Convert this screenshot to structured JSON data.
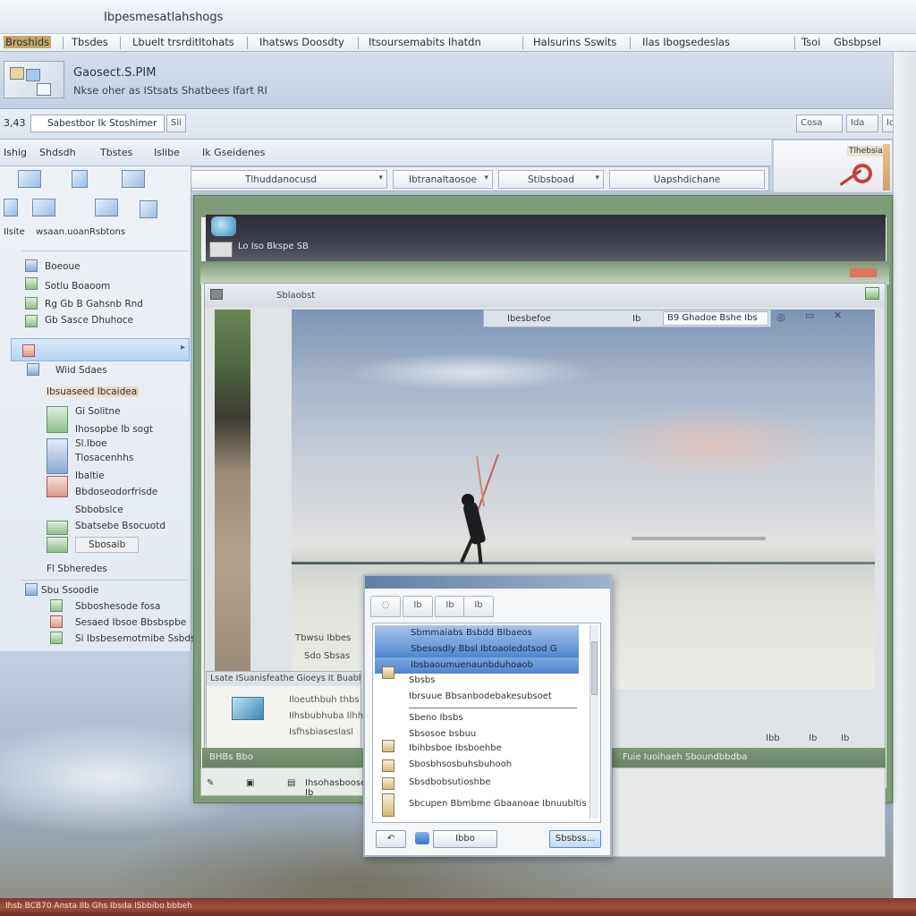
{
  "window": {
    "title": "Ibpesmesatlahshogs"
  },
  "menubar": {
    "items": [
      "Broshids",
      "Tbsdes",
      "Lbuelt trsrdit",
      "Itohats",
      "Ihatsws Doosdty",
      "Itsoursemabits Ihatdn",
      "Halsurins  Sswits",
      "Ilas Ibogsedeslas",
      "Tsoi",
      "Gbsbpsel"
    ]
  },
  "ribbon": {
    "title": "Gaosect.S.PIM",
    "subtitle": "Nkse oher as IStsats Shatbees Ifart RI"
  },
  "addressbar": {
    "num": "3,43",
    "path": "Sabestbor Ik Stoshimer",
    "path_btn": "Sli",
    "right_buttons": [
      "Cosa",
      "Ida",
      "Io"
    ]
  },
  "cmdrow": {
    "items": [
      "Ishig",
      "Shdsdh",
      "Tbstes",
      "Islibe",
      "Ik  Gseidenes"
    ]
  },
  "filters": {
    "dropdowns": [
      "Tlhuddanocusd",
      "Ibtranaltaosoe",
      "Stibsboad",
      "Uapshdichane"
    ]
  },
  "tool_badge": {
    "label": "Tlhebsiar"
  },
  "leftpanel": {
    "icons": [
      {
        "label": ""
      },
      {
        "label": ""
      },
      {
        "label": ""
      },
      {
        "label": "Ilsite"
      },
      {
        "label": "wsaan.uoan"
      },
      {
        "label": "Rsbtons"
      }
    ],
    "tree": [
      "Boeoue",
      "Sotlu Boaoom",
      "Rg Gb B Gahsnb Rnd",
      "Gb Sasce Dhuhoce",
      "Wiid Sdaes",
      "Ibsuaseed Ibcaidea",
      "Gi Solitne",
      "Ihosopbe Ib sogt",
      "Sl.Iboe",
      "Tlosacenhhs",
      "Ibaltie",
      "Bbdoseodorfrisde",
      "Sbbobslce",
      "Sbatsebe  Bsocuotd",
      "Sbosaib",
      "Fl Sbheredes",
      "Sbu Ssoodie",
      "Sbboshesode fosa",
      "Sesaed Ibsoe Bbsbspbe",
      "Si Ibsbesemotmibe Ssbdsbe"
    ]
  },
  "mainwin": {
    "darkband_text": "Lo Iso Bkspe SB",
    "subwin_title": "Sblaobst"
  },
  "photo_toolbar": {
    "items": [
      "Ibesbefoe",
      "Ib",
      "Ib"
    ],
    "field": "B9  Ghadoe Bshe Ibs"
  },
  "captions": {
    "line1": "Tbwsu  Ibbes",
    "line2": "Sdo  Sbsas"
  },
  "infopanel": {
    "header": "Lsate ISuanisfeathe   Gioeys  It Buabbes",
    "lines": [
      "Iloeuthbuh thbs",
      "Ilhsbubhuba Ilhh",
      "Isfhsbiaseslasl"
    ]
  },
  "statusrow": {
    "left": "BHBs Bbo",
    "right": "Fuie Iuoihaeh Sboundbbdba",
    "controls": [
      "Ibb",
      "Ib",
      "Ib"
    ]
  },
  "bottombar": {
    "text": "Ihsohasboose Ib"
  },
  "dialog": {
    "tabs": [
      "Ib",
      "Ib",
      "Ib"
    ],
    "items_selected": [
      "Sbmmaiabs Bsbdd Blbaeos",
      "Sbesosdly Bbsl Ibtoaoledotsod G",
      "Ibsbaoumuenaunbduhoaob"
    ],
    "items": [
      "Sbsbs",
      "Ibrsuue Bbsanbodebakesubsoet",
      "Sbeno Ibsbs",
      "Sbsosoe bsbuu",
      "Ibihbsboe Ibsboehbe",
      "Sbosbhsosbuhsbuhooh",
      "Sbsdbobsutioshbe"
    ],
    "footer_note": "Sbcupen  Bbmbme  Gbaanoae Ibnuubltis",
    "buttons": {
      "secondary": "Ibbo",
      "primary": "Sbsbss..."
    }
  },
  "taskbar": {
    "text": "Ihsb BCB70 Ansta IIb Ghs Ibsda ISbbibo bbbeh"
  }
}
